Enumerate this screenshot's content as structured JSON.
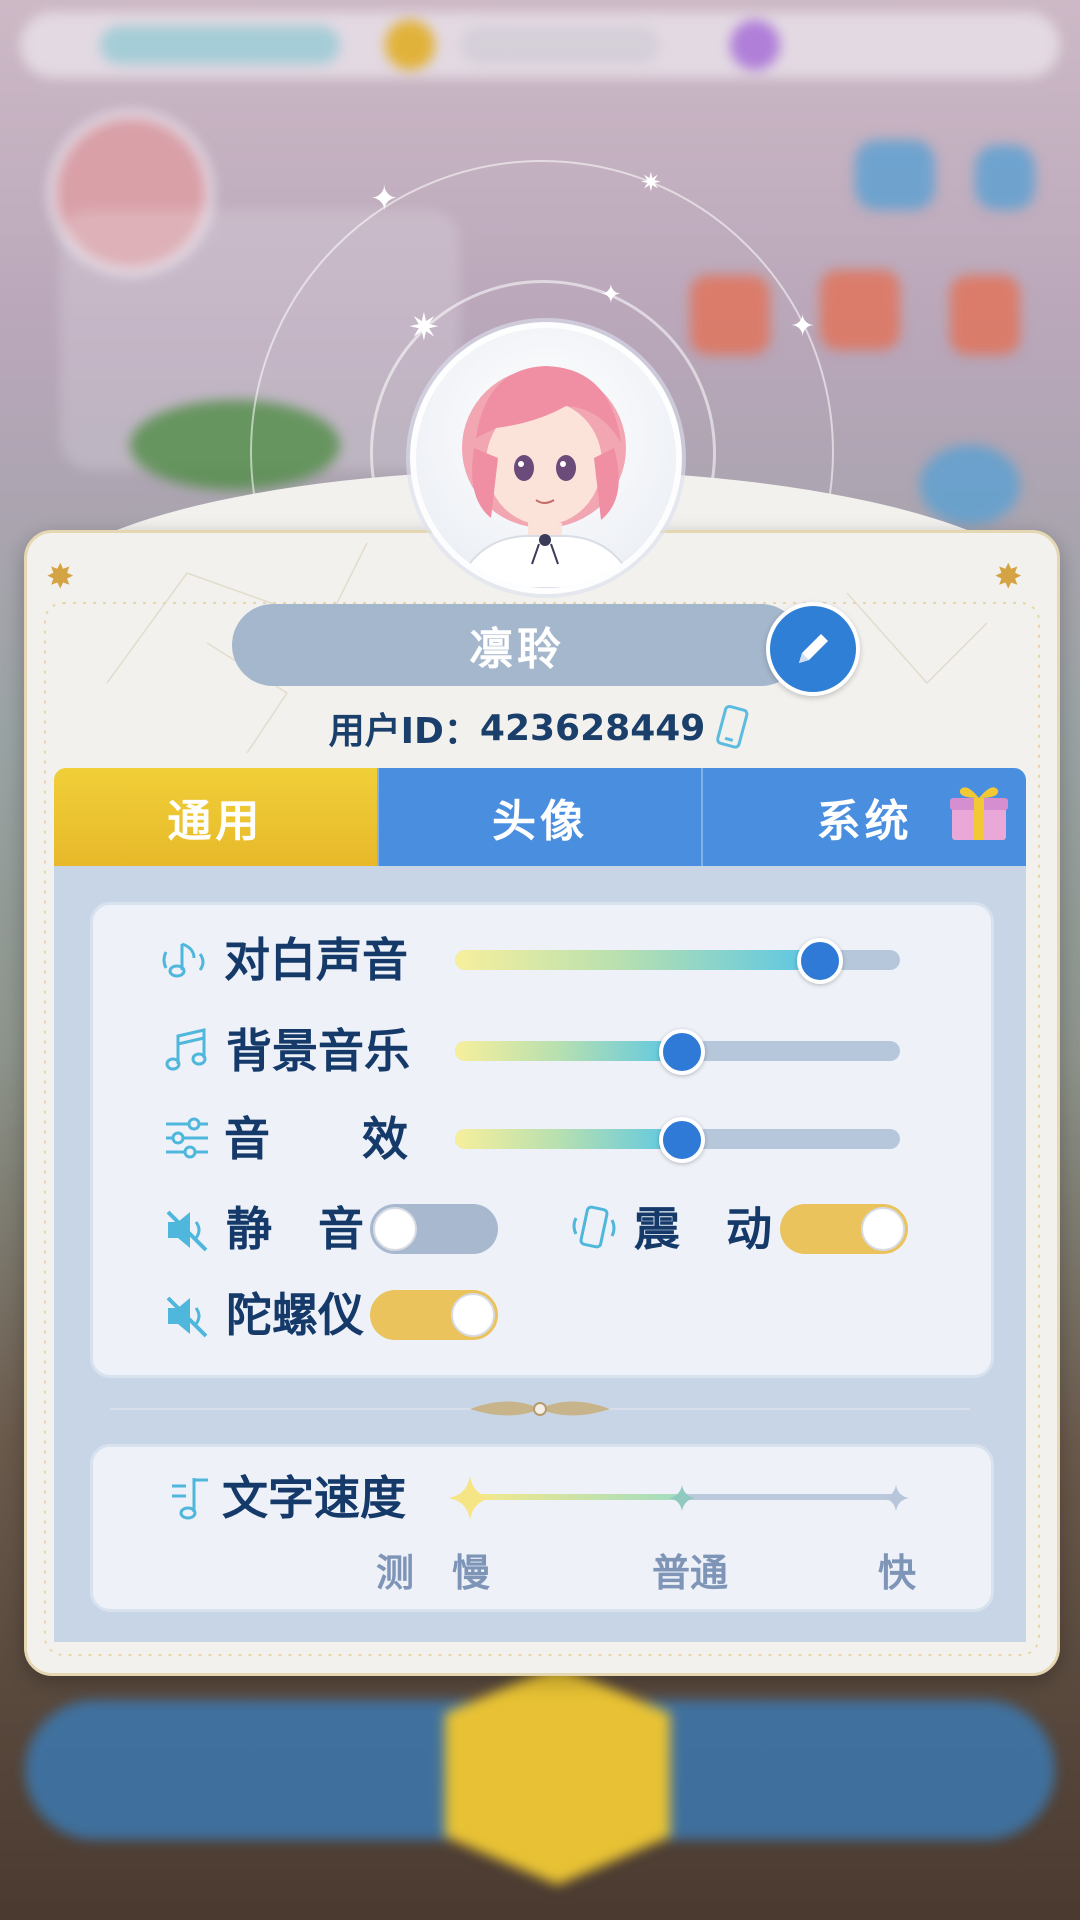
{
  "profile": {
    "name": "凛聆",
    "uid_label": "用户ID：",
    "uid_value": "423628449"
  },
  "tabs": [
    {
      "label": "通用",
      "active": true
    },
    {
      "label": "头像",
      "active": false
    },
    {
      "label": "系统",
      "active": false
    }
  ],
  "audio": {
    "dialogue": {
      "label": "对白声音",
      "value": 0.82
    },
    "bgm": {
      "label": "背景音乐",
      "value": 0.51
    },
    "sfx": {
      "label": "音　　效",
      "value": 0.51
    }
  },
  "toggles": {
    "mute": {
      "label": "静　音",
      "on": false
    },
    "vibrate": {
      "label": "震　动",
      "on": true
    },
    "gyro": {
      "label": "陀螺仪",
      "on": true
    }
  },
  "text_speed": {
    "label": "文字速度",
    "options": [
      "测",
      "慢",
      "普通",
      "快"
    ],
    "selected": "普通"
  },
  "colors": {
    "accent_blue": "#4a8fdf",
    "tab_active": "#e7b92a",
    "toggle_on": "#eac35c",
    "label_text": "#153a6a"
  }
}
